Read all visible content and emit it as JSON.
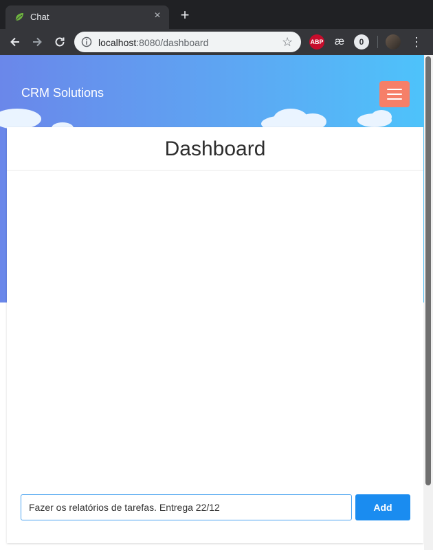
{
  "browser": {
    "tab_title": "Chat",
    "tab_close": "×",
    "new_tab": "+",
    "url_host": "localhost",
    "url_path": ":8080/dashboard",
    "extensions": {
      "abp": "ABP",
      "ae": "æ",
      "o": "0"
    }
  },
  "navbar": {
    "brand": "CRM Solutions"
  },
  "card": {
    "title": "Dashboard"
  },
  "task_form": {
    "input_value": "Fazer os relatórios de tarefas. Entrega 22/12",
    "add_label": "Add"
  },
  "colors": {
    "hero_gradient_start": "#6a87ea",
    "hero_gradient_end": "#4dc4fb",
    "hamburger_bg": "#f67f68",
    "add_button_bg": "#1a8cf0"
  }
}
